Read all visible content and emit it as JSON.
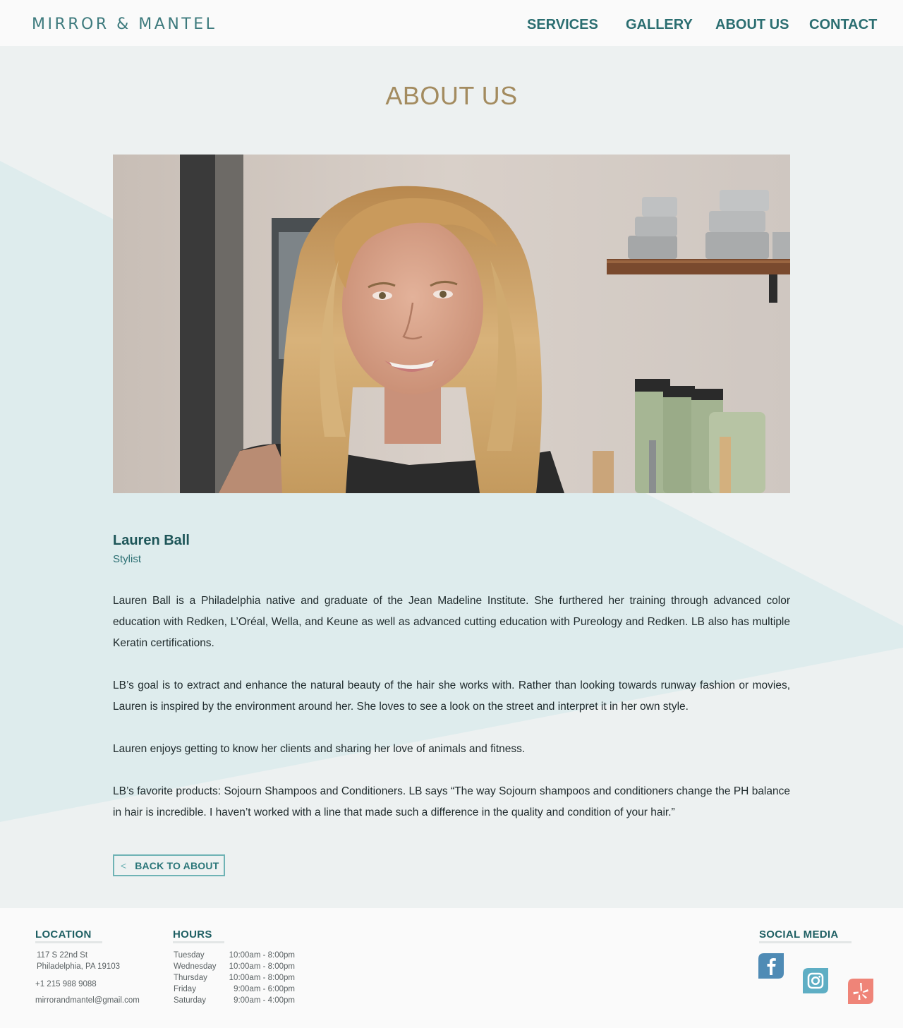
{
  "header": {
    "logo": "MIRROR & MANTEL",
    "nav": [
      {
        "label": "SERVICES"
      },
      {
        "label": "GALLERY"
      },
      {
        "label": "ABOUT US"
      },
      {
        "label": "CONTACT"
      }
    ]
  },
  "main": {
    "title": "ABOUT US",
    "profile": {
      "name": "Lauren Ball",
      "role": "Stylist",
      "paragraphs": [
        "Lauren Ball is a Philadelphia native and graduate of the Jean Madeline Institute. She furthered her training through advanced color education with Redken, L’Oréal, Wella, and Keune as well as advanced cutting education with Pureology and Redken. LB also has multiple Keratin certifications.",
        "LB’s goal is to extract and enhance the natural beauty of the hair she works with. Rather than looking towards runway fashion or movies, Lauren is inspired by the environment around her. She loves to see a look on the street and interpret it in her own style.",
        "Lauren enjoys getting to know her clients and sharing her love of animals and fitness.",
        "LB’s favorite products: Sojourn Shampoos and Conditioners. LB says “The way Sojourn shampoos and conditioners change the PH balance in hair is incredible. I haven’t worked with a line that made such a difference in the quality and condition of your hair.”"
      ]
    },
    "back_button": {
      "chevron": "<",
      "label": "BACK TO ABOUT"
    }
  },
  "footer": {
    "location": {
      "heading": "LOCATION",
      "street": "117 S 22nd St",
      "city": "Philadelphia, PA 19103",
      "phone": "+1 215 988 9088",
      "email": "mirrorandmantel@gmail.com"
    },
    "hours": {
      "heading": "HOURS",
      "rows": [
        {
          "day": "Tuesday",
          "time": "10:00am - 8:00pm"
        },
        {
          "day": "Wednesday",
          "time": "10:00am - 8:00pm"
        },
        {
          "day": "Thursday",
          "time": "10:00am - 8:00pm"
        },
        {
          "day": "Friday",
          "time": "9:00am - 6:00pm"
        },
        {
          "day": "Saturday",
          "time": "9:00am - 4:00pm"
        }
      ]
    },
    "social": {
      "heading": "SOCIAL MEDIA",
      "icons": [
        "facebook-icon",
        "instagram-icon",
        "yelp-icon"
      ]
    }
  },
  "colors": {
    "accent_teal": "#2b6e71",
    "title_gold": "#a38b5f",
    "background": "#edf1f1",
    "triangle": "#deeced",
    "facebook": "#4f8bb5",
    "instagram": "#5eaec4",
    "yelp": "#ef8478"
  }
}
